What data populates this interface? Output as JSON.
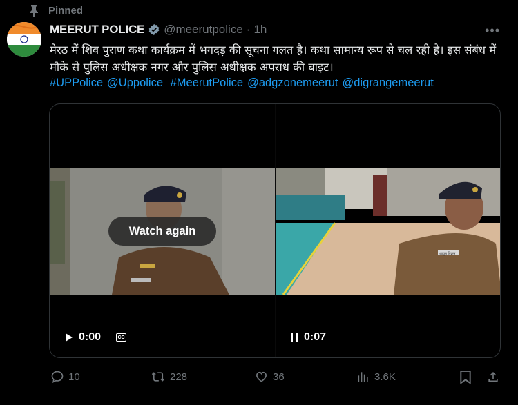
{
  "pinned": {
    "label": "Pinned"
  },
  "author": {
    "display_name": "MEERUT POLICE",
    "handle": "@meerutpolice",
    "separator": "·",
    "time": "1h"
  },
  "tweet": {
    "text": "मेरठ में शिव पुराण कथा कार्यक्रम में भगदड़ की सूचना गलत है। कथा सामान्य रूप से चल रही हे। इस संबंध में मौके से पुलिस अधीक्षक नगर और पुलिस अधीक्षक अपराध की बाइट।",
    "hashtags": [
      "#UPPolice",
      "@Uppolice",
      "#MeerutPolice",
      "@adgzonemeerut",
      "@digrangemeerut"
    ]
  },
  "media": {
    "left": {
      "overlay": "Watch again",
      "time": "0:00",
      "cc": "CC"
    },
    "right": {
      "time": "0:07",
      "badge_text": "आयुष विक्रम"
    }
  },
  "actions": {
    "replies": "10",
    "reposts": "228",
    "likes": "36",
    "views": "3.6K"
  },
  "colors": {
    "accent": "#1d9bf0",
    "muted": "#71767b",
    "text": "#e7e9ea"
  }
}
